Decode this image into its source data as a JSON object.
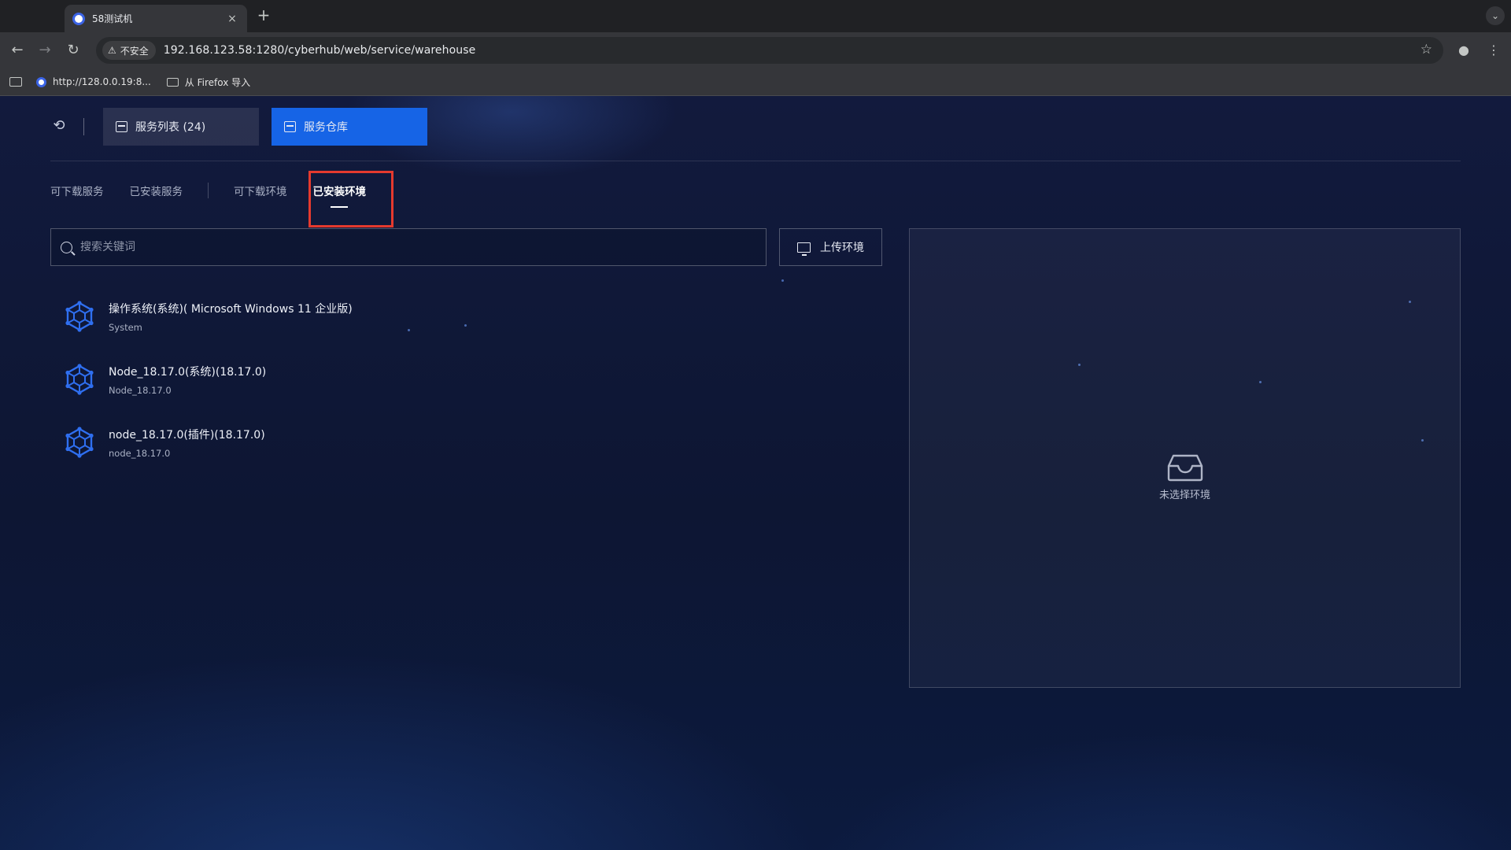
{
  "browser": {
    "tab_title": "58测试机",
    "tab_close": "×",
    "new_tab": "+",
    "security_label": "不安全",
    "url": "192.168.123.58:1280/cyberhub/web/service/warehouse",
    "bookmarks": [
      {
        "label": "http://128.0.0.19:8..."
      },
      {
        "label": "从 Firefox 导入"
      }
    ]
  },
  "topbar": {
    "service_list_label": "服务列表 (24)",
    "warehouse_label": "服务仓库"
  },
  "subtabs": [
    "可下载服务",
    "已安装服务",
    "可下载环境",
    "已安装环境"
  ],
  "active_subtab": "已安装环境",
  "search": {
    "placeholder": "搜索关键词",
    "value": ""
  },
  "upload_button": "上传环境",
  "environments": [
    {
      "name": "操作系统(系统)( Microsoft Windows 11 企业版)",
      "sub": "System"
    },
    {
      "name": "Node_18.17.0(系统)(18.17.0)",
      "sub": "Node_18.17.0"
    },
    {
      "name": "node_18.17.0(插件)(18.17.0)",
      "sub": "node_18.17.0"
    }
  ],
  "detail": {
    "empty_text": "未选择环境"
  },
  "colors": {
    "accent": "#1664e6",
    "highlight": "#e53a2e",
    "icon_blue": "#2f6ff0"
  },
  "icons": {
    "back": "undo-arrow-icon",
    "service_list": "server-list-icon",
    "warehouse": "box-icon",
    "search": "search-icon",
    "upload": "monitor-upload-icon",
    "environment": "hexagon-network-icon",
    "empty": "inbox-icon"
  }
}
